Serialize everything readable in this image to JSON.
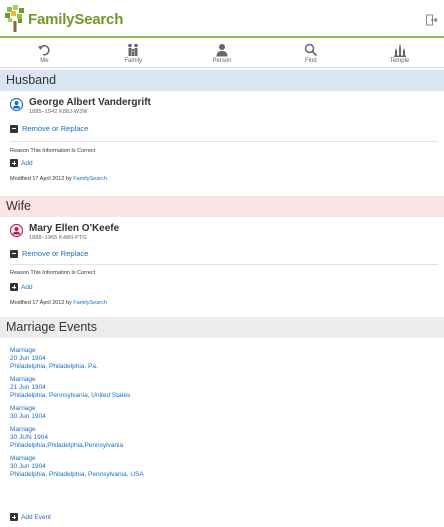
{
  "header": {
    "logo_text": "FamilySearch",
    "exit_icon": "sign-out-icon"
  },
  "nav": [
    {
      "label": "Me",
      "icon": "undo-arrow-icon"
    },
    {
      "label": "Family",
      "icon": "family-icon"
    },
    {
      "label": "Person",
      "icon": "person-icon"
    },
    {
      "label": "Find",
      "icon": "search-icon"
    },
    {
      "label": "Temple",
      "icon": "temple-icon"
    }
  ],
  "husband": {
    "heading": "Husband",
    "name": "George Albert Vandergrift",
    "meta": "1885–1942 K88J-W3W",
    "remove_label": "Remove or Replace",
    "reason_label": "Reason This Information Is Correct",
    "add_label": "Add",
    "modified_prefix": "Modified 17 April 2012 by",
    "modified_by": "FamilySearch",
    "icon_color": "#1a6ec2"
  },
  "wife": {
    "heading": "Wife",
    "name": "Mary Ellen O'Keefe",
    "meta": "1888–1965 K48N-PTG",
    "remove_label": "Remove or Replace",
    "reason_label": "Reason This Information Is Correct",
    "add_label": "Add",
    "modified_prefix": "Modified 17 April 2012 by",
    "modified_by": "FamilySearch",
    "icon_color": "#c2185b"
  },
  "marriage": {
    "heading": "Marriage Events",
    "events": [
      {
        "type": "Marriage",
        "date": "20 Jun 1904",
        "place": "Philadelphia, Philadelphia, Pa."
      },
      {
        "type": "Marriage",
        "date": "21 Jun 1904",
        "place": "Philadelphia, Pennsylvania, United States"
      },
      {
        "type": "Marriage",
        "date": "30 Jun 1904",
        "place": ""
      },
      {
        "type": "Marriage",
        "date": "30 JUN 1904",
        "place": "Philadelphia,Philadelphia,Pennsylvania"
      },
      {
        "type": "Marriage",
        "date": "30 Jun 1904",
        "place": "Philadelphia, Philadelphia, Pennsylvania, USA"
      }
    ],
    "add_event_label": "Add Event"
  },
  "colors": {
    "brand_green": "#6d9a2c",
    "link_blue": "#1a6ec2",
    "husband_bg": "#d9e6f2",
    "wife_bg": "#fae3e3",
    "marriage_bg": "#ececec"
  }
}
